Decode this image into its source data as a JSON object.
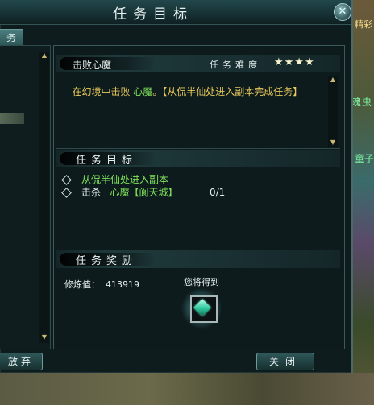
{
  "window": {
    "title": "任务目标",
    "close_icon": "✕"
  },
  "left": {
    "tab_label": "务",
    "abandon_label": "放弃"
  },
  "quest": {
    "name": "击败心魔",
    "difficulty_label": "任务难度",
    "stars": "★★★★",
    "star_count": 4,
    "desc_part1": "在幻境中击败 ",
    "desc_green": "心魔",
    "desc_part2": "。【从侃半仙处进入副本完成任务】"
  },
  "objectives": {
    "heading": "任务目标",
    "item1": "从侃半仙处进入副本",
    "item2_prefix": "击杀",
    "item2_target": "心魔【阆天城】",
    "item2_count": "0/1"
  },
  "rewards": {
    "heading": "任务奖励",
    "xp_label": "修炼值：",
    "xp_value": "413919",
    "receive_label": "您将得到"
  },
  "buttons": {
    "close_label": "关闭"
  },
  "background": {
    "npc_label1": "魂虫",
    "npc_label2": "童子",
    "sign": "精彩"
  },
  "colors": {
    "green_text": "#7fe35a",
    "gold_text": "#e6c85b",
    "stars": "#f3f0cc"
  }
}
